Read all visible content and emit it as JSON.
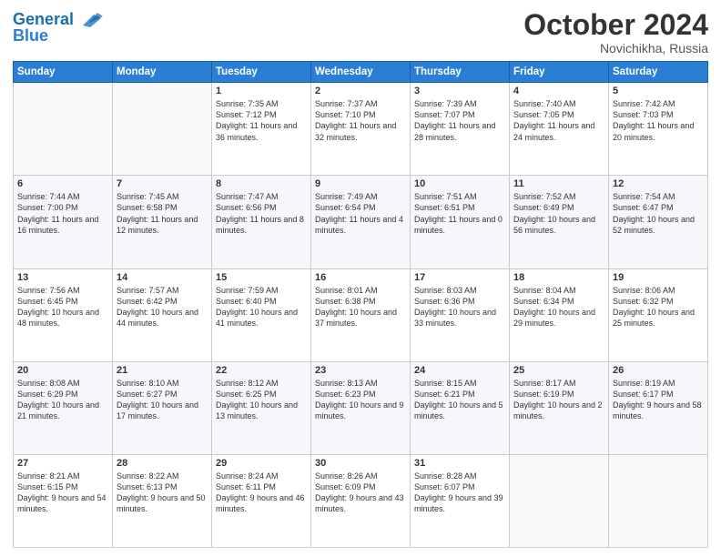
{
  "header": {
    "logo_line1": "General",
    "logo_line2": "Blue",
    "month": "October 2024",
    "location": "Novichikha, Russia"
  },
  "days_of_week": [
    "Sunday",
    "Monday",
    "Tuesday",
    "Wednesday",
    "Thursday",
    "Friday",
    "Saturday"
  ],
  "weeks": [
    [
      {
        "day": "",
        "content": ""
      },
      {
        "day": "",
        "content": ""
      },
      {
        "day": "1",
        "content": "Sunrise: 7:35 AM\nSunset: 7:12 PM\nDaylight: 11 hours\nand 36 minutes."
      },
      {
        "day": "2",
        "content": "Sunrise: 7:37 AM\nSunset: 7:10 PM\nDaylight: 11 hours\nand 32 minutes."
      },
      {
        "day": "3",
        "content": "Sunrise: 7:39 AM\nSunset: 7:07 PM\nDaylight: 11 hours\nand 28 minutes."
      },
      {
        "day": "4",
        "content": "Sunrise: 7:40 AM\nSunset: 7:05 PM\nDaylight: 11 hours\nand 24 minutes."
      },
      {
        "day": "5",
        "content": "Sunrise: 7:42 AM\nSunset: 7:03 PM\nDaylight: 11 hours\nand 20 minutes."
      }
    ],
    [
      {
        "day": "6",
        "content": "Sunrise: 7:44 AM\nSunset: 7:00 PM\nDaylight: 11 hours\nand 16 minutes."
      },
      {
        "day": "7",
        "content": "Sunrise: 7:45 AM\nSunset: 6:58 PM\nDaylight: 11 hours\nand 12 minutes."
      },
      {
        "day": "8",
        "content": "Sunrise: 7:47 AM\nSunset: 6:56 PM\nDaylight: 11 hours\nand 8 minutes."
      },
      {
        "day": "9",
        "content": "Sunrise: 7:49 AM\nSunset: 6:54 PM\nDaylight: 11 hours\nand 4 minutes."
      },
      {
        "day": "10",
        "content": "Sunrise: 7:51 AM\nSunset: 6:51 PM\nDaylight: 11 hours\nand 0 minutes."
      },
      {
        "day": "11",
        "content": "Sunrise: 7:52 AM\nSunset: 6:49 PM\nDaylight: 10 hours\nand 56 minutes."
      },
      {
        "day": "12",
        "content": "Sunrise: 7:54 AM\nSunset: 6:47 PM\nDaylight: 10 hours\nand 52 minutes."
      }
    ],
    [
      {
        "day": "13",
        "content": "Sunrise: 7:56 AM\nSunset: 6:45 PM\nDaylight: 10 hours\nand 48 minutes."
      },
      {
        "day": "14",
        "content": "Sunrise: 7:57 AM\nSunset: 6:42 PM\nDaylight: 10 hours\nand 44 minutes."
      },
      {
        "day": "15",
        "content": "Sunrise: 7:59 AM\nSunset: 6:40 PM\nDaylight: 10 hours\nand 41 minutes."
      },
      {
        "day": "16",
        "content": "Sunrise: 8:01 AM\nSunset: 6:38 PM\nDaylight: 10 hours\nand 37 minutes."
      },
      {
        "day": "17",
        "content": "Sunrise: 8:03 AM\nSunset: 6:36 PM\nDaylight: 10 hours\nand 33 minutes."
      },
      {
        "day": "18",
        "content": "Sunrise: 8:04 AM\nSunset: 6:34 PM\nDaylight: 10 hours\nand 29 minutes."
      },
      {
        "day": "19",
        "content": "Sunrise: 8:06 AM\nSunset: 6:32 PM\nDaylight: 10 hours\nand 25 minutes."
      }
    ],
    [
      {
        "day": "20",
        "content": "Sunrise: 8:08 AM\nSunset: 6:29 PM\nDaylight: 10 hours\nand 21 minutes."
      },
      {
        "day": "21",
        "content": "Sunrise: 8:10 AM\nSunset: 6:27 PM\nDaylight: 10 hours\nand 17 minutes."
      },
      {
        "day": "22",
        "content": "Sunrise: 8:12 AM\nSunset: 6:25 PM\nDaylight: 10 hours\nand 13 minutes."
      },
      {
        "day": "23",
        "content": "Sunrise: 8:13 AM\nSunset: 6:23 PM\nDaylight: 10 hours\nand 9 minutes."
      },
      {
        "day": "24",
        "content": "Sunrise: 8:15 AM\nSunset: 6:21 PM\nDaylight: 10 hours\nand 5 minutes."
      },
      {
        "day": "25",
        "content": "Sunrise: 8:17 AM\nSunset: 6:19 PM\nDaylight: 10 hours\nand 2 minutes."
      },
      {
        "day": "26",
        "content": "Sunrise: 8:19 AM\nSunset: 6:17 PM\nDaylight: 9 hours\nand 58 minutes."
      }
    ],
    [
      {
        "day": "27",
        "content": "Sunrise: 8:21 AM\nSunset: 6:15 PM\nDaylight: 9 hours\nand 54 minutes."
      },
      {
        "day": "28",
        "content": "Sunrise: 8:22 AM\nSunset: 6:13 PM\nDaylight: 9 hours\nand 50 minutes."
      },
      {
        "day": "29",
        "content": "Sunrise: 8:24 AM\nSunset: 6:11 PM\nDaylight: 9 hours\nand 46 minutes."
      },
      {
        "day": "30",
        "content": "Sunrise: 8:26 AM\nSunset: 6:09 PM\nDaylight: 9 hours\nand 43 minutes."
      },
      {
        "day": "31",
        "content": "Sunrise: 8:28 AM\nSunset: 6:07 PM\nDaylight: 9 hours\nand 39 minutes."
      },
      {
        "day": "",
        "content": ""
      },
      {
        "day": "",
        "content": ""
      }
    ]
  ]
}
